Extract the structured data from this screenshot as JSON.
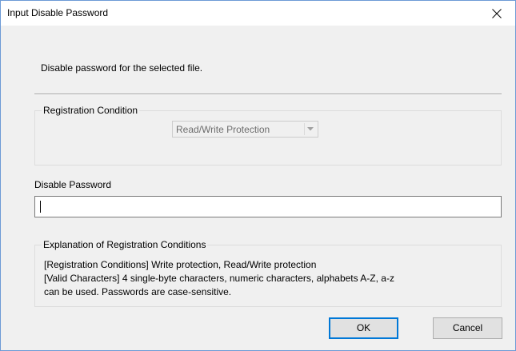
{
  "window": {
    "title": "Input Disable Password",
    "close_icon": "close-icon"
  },
  "instruction": "Disable password for the selected file.",
  "registration_condition": {
    "legend": "Registration Condition",
    "combo_value": "Read/Write Protection",
    "combo_enabled": false
  },
  "password": {
    "label": "Disable Password",
    "value": ""
  },
  "explanation": {
    "legend": "Explanation of Registration Conditions",
    "line1": "[Registration Conditions] Write protection, Read/Write protection",
    "line2": "[Valid Characters] 4 single-byte characters, numeric characters, alphabets A-Z, a-z",
    "line3": "can be used. Passwords are case-sensitive."
  },
  "buttons": {
    "ok": "OK",
    "cancel": "Cancel"
  },
  "colors": {
    "accent": "#0078d7",
    "window_border": "#6d9ad6",
    "dialog_bg": "#f0f0f0"
  }
}
